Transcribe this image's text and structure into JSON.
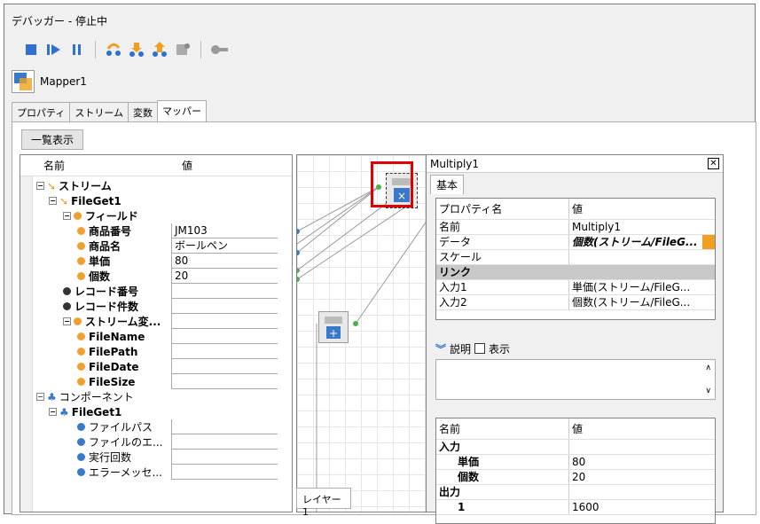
{
  "window": {
    "title": "デバッガー - 停止中"
  },
  "toolbar": {
    "icons": [
      "stop-icon",
      "step-icon",
      "pause-icon",
      "step-over-icon",
      "step-into-icon",
      "step-out-icon",
      "run-to-cursor-icon",
      "breakpoint-icon"
    ]
  },
  "mapper": {
    "label": "Mapper1"
  },
  "tabs": [
    "プロパティ",
    "ストリーム",
    "変数",
    "マッパー"
  ],
  "list_button": "一覧表示",
  "tree": {
    "headers": {
      "name": "名前",
      "value": "値"
    },
    "rows": [
      {
        "label": "ストリーム",
        "value": ""
      },
      {
        "label": "FileGet1",
        "value": ""
      },
      {
        "label": "フィールド",
        "value": ""
      },
      {
        "label": "商品番号",
        "value": "JM103"
      },
      {
        "label": "商品名",
        "value": "ボールペン"
      },
      {
        "label": "単価",
        "value": "80"
      },
      {
        "label": "個数",
        "value": "20"
      },
      {
        "label": "レコード番号",
        "value": ""
      },
      {
        "label": "レコード件数",
        "value": ""
      },
      {
        "label": "ストリーム変...",
        "value": ""
      },
      {
        "label": "FileName",
        "value": ""
      },
      {
        "label": "FilePath",
        "value": ""
      },
      {
        "label": "FileDate",
        "value": ""
      },
      {
        "label": "FileSize",
        "value": ""
      },
      {
        "label": "コンポーネント",
        "value": ""
      },
      {
        "label": "FileGet1",
        "value": ""
      },
      {
        "label": "ファイルパス",
        "value": ""
      },
      {
        "label": "ファイルのエ...",
        "value": ""
      },
      {
        "label": "実行回数",
        "value": ""
      },
      {
        "label": "エラーメッセ...",
        "value": ""
      }
    ]
  },
  "canvas": {
    "layer_tab": "レイヤー1"
  },
  "props": {
    "title": "Multiply1",
    "tab": "基本",
    "headers": {
      "name": "プロパティ名",
      "value": "値"
    },
    "rows": [
      {
        "k": "名前",
        "v": "Multiply1"
      },
      {
        "k": "データ",
        "v": "個数(ストリーム/FileG..."
      },
      {
        "k": "スケール",
        "v": ""
      },
      {
        "k": "リンク",
        "v": ""
      },
      {
        "k": "入力1",
        "v": "単価(ストリーム/FileG..."
      },
      {
        "k": "入力2",
        "v": "個数(ストリーム/FileG..."
      }
    ],
    "desc_label": "説明",
    "show_label": "表示",
    "var_headers": {
      "name": "名前",
      "value": "値"
    },
    "var_rows": [
      {
        "k": "入力",
        "v": ""
      },
      {
        "k": "単価",
        "v": "80"
      },
      {
        "k": "個数",
        "v": "20"
      },
      {
        "k": "出力",
        "v": ""
      },
      {
        "k": "1",
        "v": "1600"
      }
    ]
  }
}
